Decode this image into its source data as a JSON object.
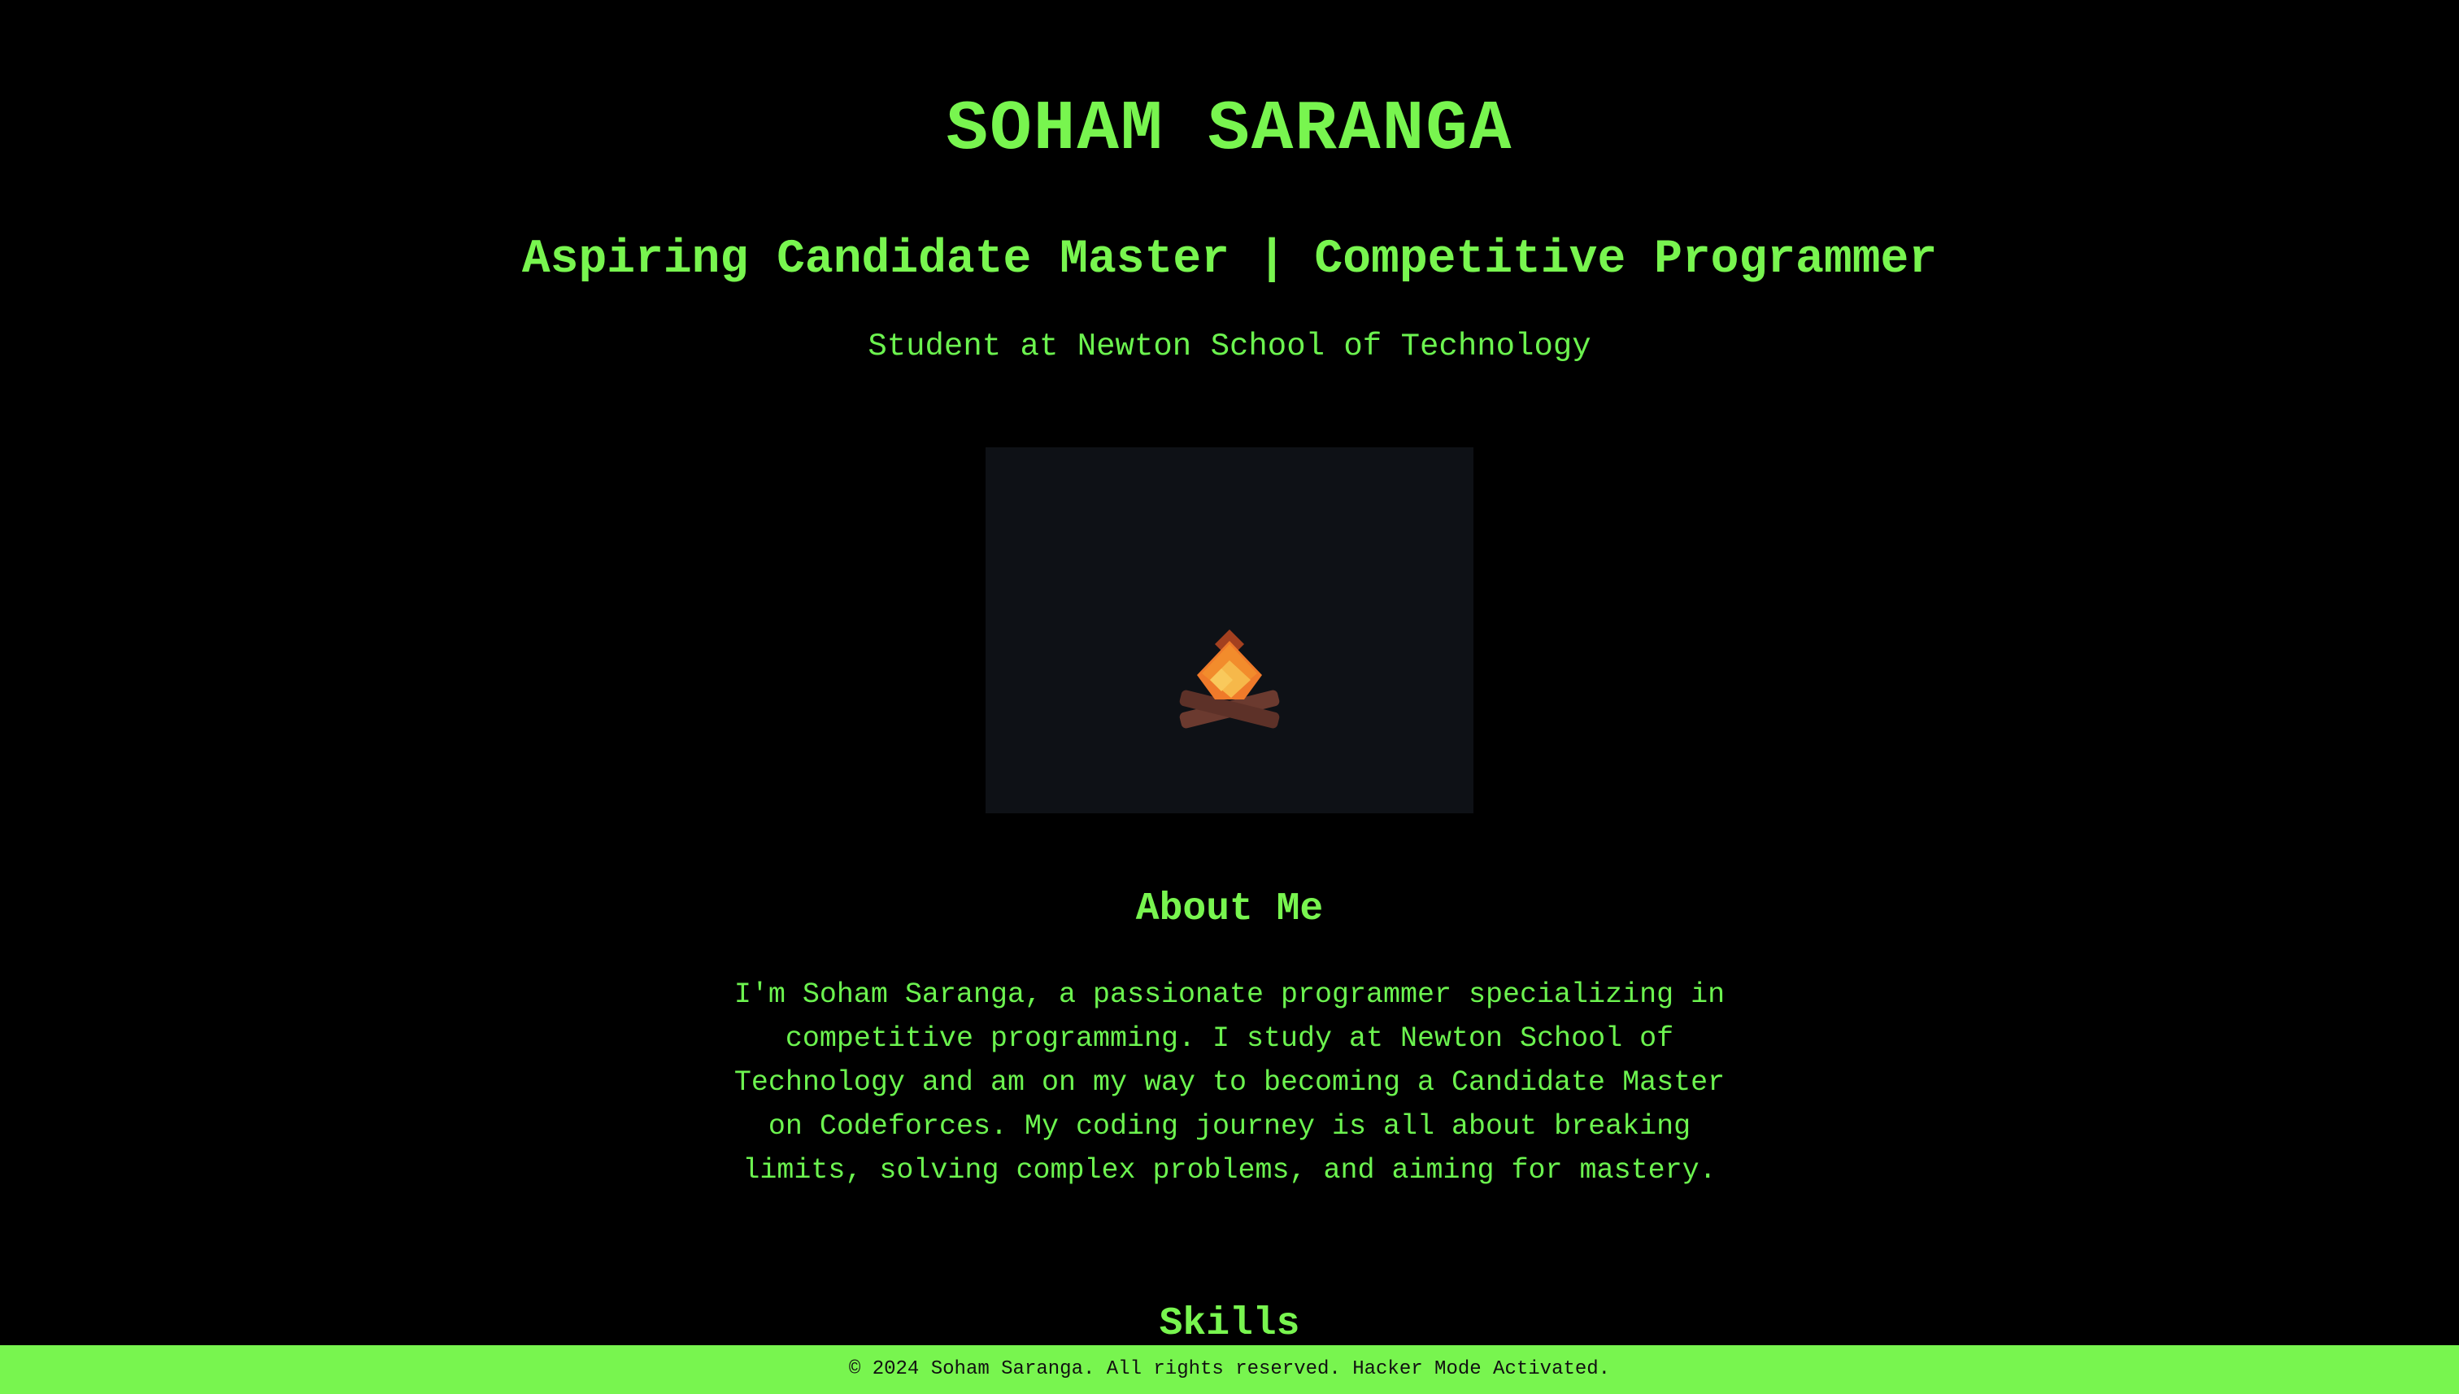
{
  "header": {
    "name": "SOHAM SARANGA",
    "tagline": "Aspiring Candidate Master | Competitive Programmer",
    "subtitle": "Student at Newton School of Technology"
  },
  "media": {
    "icon": "campfire-icon"
  },
  "about": {
    "title": "About Me",
    "text": "I'm Soham Saranga, a passionate programmer specializing in competitive programming. I study at Newton School of Technology and am on my way to becoming a Candidate Master on Codeforces. My coding journey is all about breaking limits, solving complex problems, and aiming for mastery."
  },
  "skills": {
    "title": "Skills"
  },
  "footer": {
    "text": "© 2024 Soham Saranga. All rights reserved. Hacker Mode Activated."
  },
  "colors": {
    "background": "#000000",
    "accent": "#78f54f",
    "media_background": "#0e1116"
  }
}
